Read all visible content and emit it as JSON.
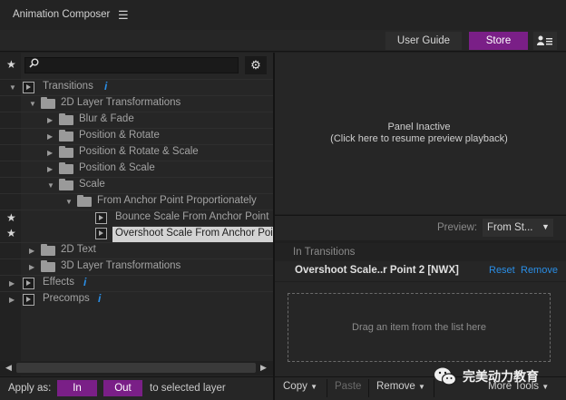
{
  "app": {
    "title": "Animation Composer",
    "menu_icon": "hamburger-icon"
  },
  "topbar": {
    "user_guide": "User Guide",
    "store": "Store",
    "account_icon": "user-list-icon"
  },
  "colors": {
    "accent": "#7a1f87",
    "link": "#2a8ee6",
    "selected_row": "#d3d3d3"
  },
  "search": {
    "placeholder": "",
    "value": ""
  },
  "tree": [
    {
      "label": "Transitions",
      "icon": "preset-folder-icon",
      "expanded": true,
      "info": "i"
    },
    {
      "label": "2D Layer Transformations",
      "icon": "folder-icon",
      "expanded": true
    },
    {
      "label": "Blur & Fade",
      "icon": "folder-icon",
      "expanded": false
    },
    {
      "label": "Position & Rotate",
      "icon": "folder-icon",
      "expanded": false
    },
    {
      "label": "Position & Rotate & Scale",
      "icon": "folder-icon",
      "expanded": false
    },
    {
      "label": "Position & Scale",
      "icon": "folder-icon",
      "expanded": false
    },
    {
      "label": "Scale",
      "icon": "folder-icon",
      "expanded": true
    },
    {
      "label": "From Anchor Point Proportionately",
      "icon": "folder-icon",
      "expanded": true
    },
    {
      "label": "Bounce Scale From Anchor Point",
      "icon": "preset-icon",
      "favorite": true
    },
    {
      "label": "Overshoot Scale From Anchor Point",
      "icon": "preset-icon",
      "favorite": true,
      "selected": true
    },
    {
      "label": "2D Text",
      "icon": "folder-icon",
      "expanded": false
    },
    {
      "label": "3D Layer Transformations",
      "icon": "folder-icon",
      "expanded": false
    },
    {
      "label": "Effects",
      "icon": "effects-icon",
      "expanded": false,
      "info": "i"
    },
    {
      "label": "Precomps",
      "icon": "precomps-icon",
      "expanded": false,
      "info": "i"
    }
  ],
  "apply": {
    "label": "Apply as:",
    "in": "In",
    "out": "Out",
    "suffix": "to selected layer"
  },
  "preview": {
    "line1": "Panel Inactive",
    "line2": "(Click here to resume preview playback)",
    "label": "Preview:",
    "select_value": "From St..."
  },
  "transitions": {
    "section": "In Transitions",
    "item_name": "Overshoot Scale..r Point 2 [NWX]",
    "reset": "Reset",
    "remove": "Remove",
    "drop_hint": "Drag an item from the list here"
  },
  "bottom": {
    "copy": "Copy",
    "paste": "Paste",
    "remove": "Remove",
    "more_tools": "More Tools"
  },
  "watermark": {
    "text": "完美动力教育"
  }
}
